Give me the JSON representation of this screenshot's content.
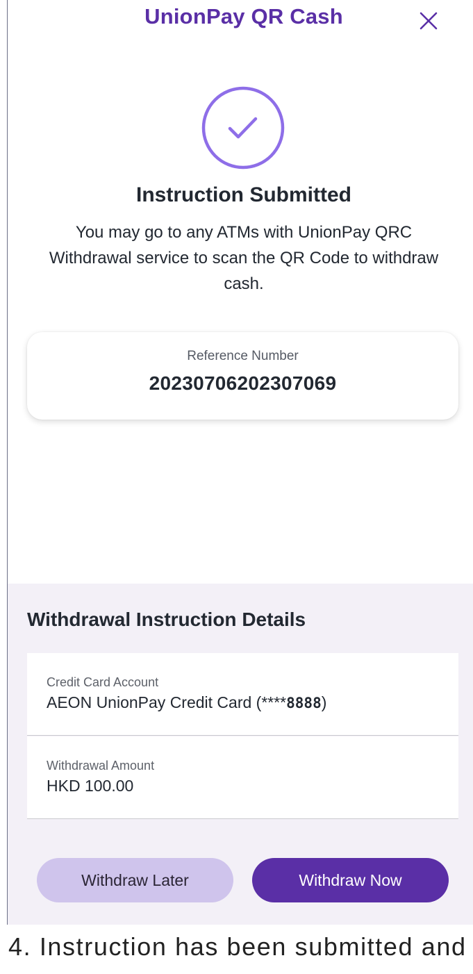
{
  "header": {
    "title": "UnionPay QR Cash",
    "close_icon": "close-icon"
  },
  "status": {
    "icon": "checkmark-circle-icon",
    "title": "Instruction Submitted",
    "description": "You may go to any ATMs with UnionPay QRC Withdrawal service to scan the QR Code to withdraw cash."
  },
  "reference": {
    "label": "Reference Number",
    "value": "20230706202307069"
  },
  "details": {
    "title": "Withdrawal Instruction Details",
    "rows": [
      {
        "label": "Credit Card Account",
        "value_prefix": "AEON UnionPay Credit Card (****",
        "value_digits": "8888",
        "value_suffix": ")"
      },
      {
        "label": "Withdrawal Amount",
        "value": "HKD 100.00"
      }
    ]
  },
  "actions": {
    "withdraw_later": "Withdraw Later",
    "withdraw_now": "Withdraw Now"
  },
  "caption": "4. Instruction has been submitted and",
  "colors": {
    "brand_purple": "#5a2fa6",
    "icon_purple": "#8e6ee8",
    "secondary_button": "#cfc4ec",
    "details_background": "#f3f0f7"
  }
}
